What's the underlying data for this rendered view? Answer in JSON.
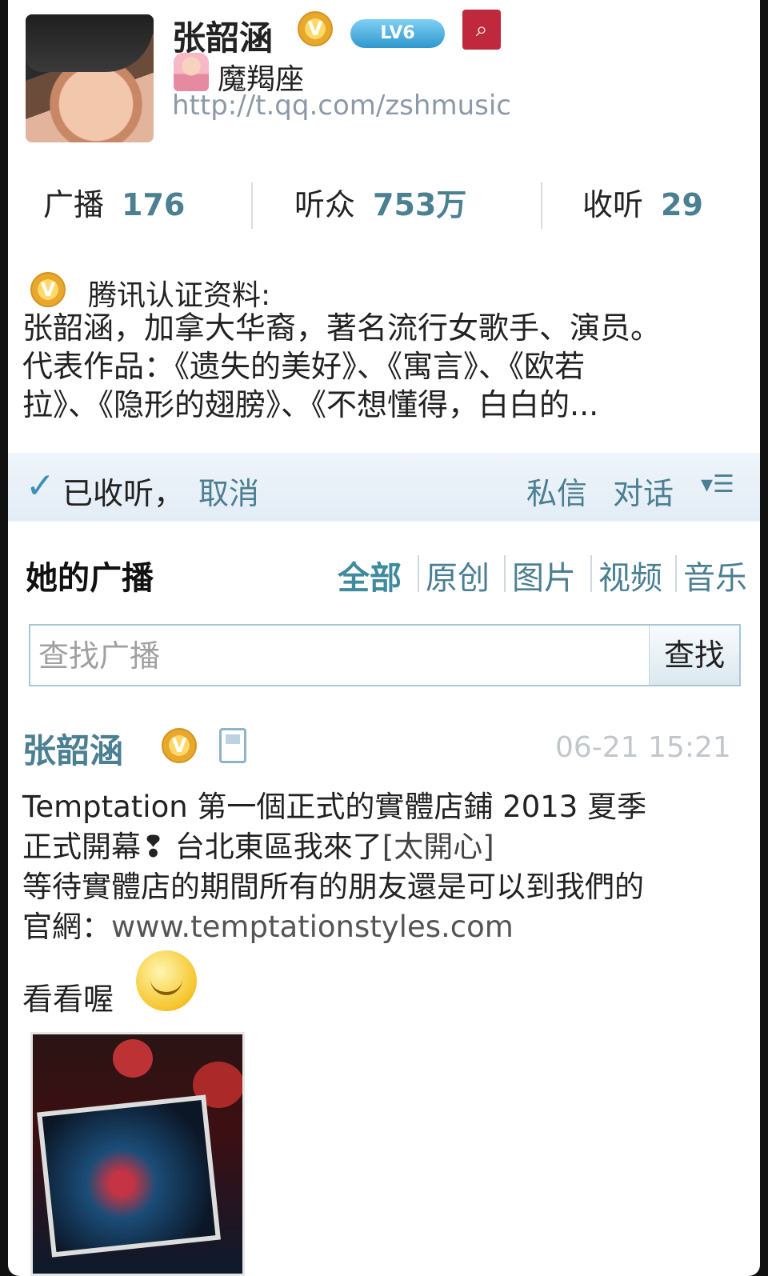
{
  "profile": {
    "name": "张韶涵",
    "verified_icon": "verified-badge-icon",
    "level": "LV6",
    "zodiac": "魔羯座",
    "url": "http://t.qq.com/zshmusic"
  },
  "stats": [
    {
      "label": "广播",
      "value": "176"
    },
    {
      "label": "听众",
      "value": "753万"
    },
    {
      "label": "收听",
      "value": "29"
    }
  ],
  "cert": {
    "title": "腾讯认证资料:",
    "body": "张韶涵，加拿大华裔，著名流行女歌手、演员。\n代表作品：《遗失的美好》、《寓言》、《欧若\n拉》、《隐形的翅膀》、《不想懂得，白白的..."
  },
  "follow_bar": {
    "check": "✓",
    "followed": "已收听，",
    "unfollow": "取消",
    "private_message": "私信",
    "dialog": "对话",
    "more": "▾☰"
  },
  "broadcasts": {
    "title": "她的广播",
    "tabs": [
      "全部",
      "原创",
      "图片",
      "视频",
      "音乐"
    ],
    "active_tab": "全部",
    "search_placeholder": "查找广播",
    "search_button": "查找"
  },
  "post": {
    "author": "张韶涵",
    "time": "06-21 15:21",
    "line1": "Temptation 第一個正式的實體店鋪 2013 夏季",
    "line2a": "正式開幕❢ 台北東區我來了",
    "line2b": "[太開心]",
    "line3": "等待實體店的期間所有的朋友還是可以到我們的",
    "line4a": "官網：",
    "line4b": "www.temptationstyles.com",
    "after": "看看喔"
  },
  "colors": {
    "link": "#4b7f92",
    "verified": "#e8a82b",
    "accent": "#3e8fb5"
  }
}
